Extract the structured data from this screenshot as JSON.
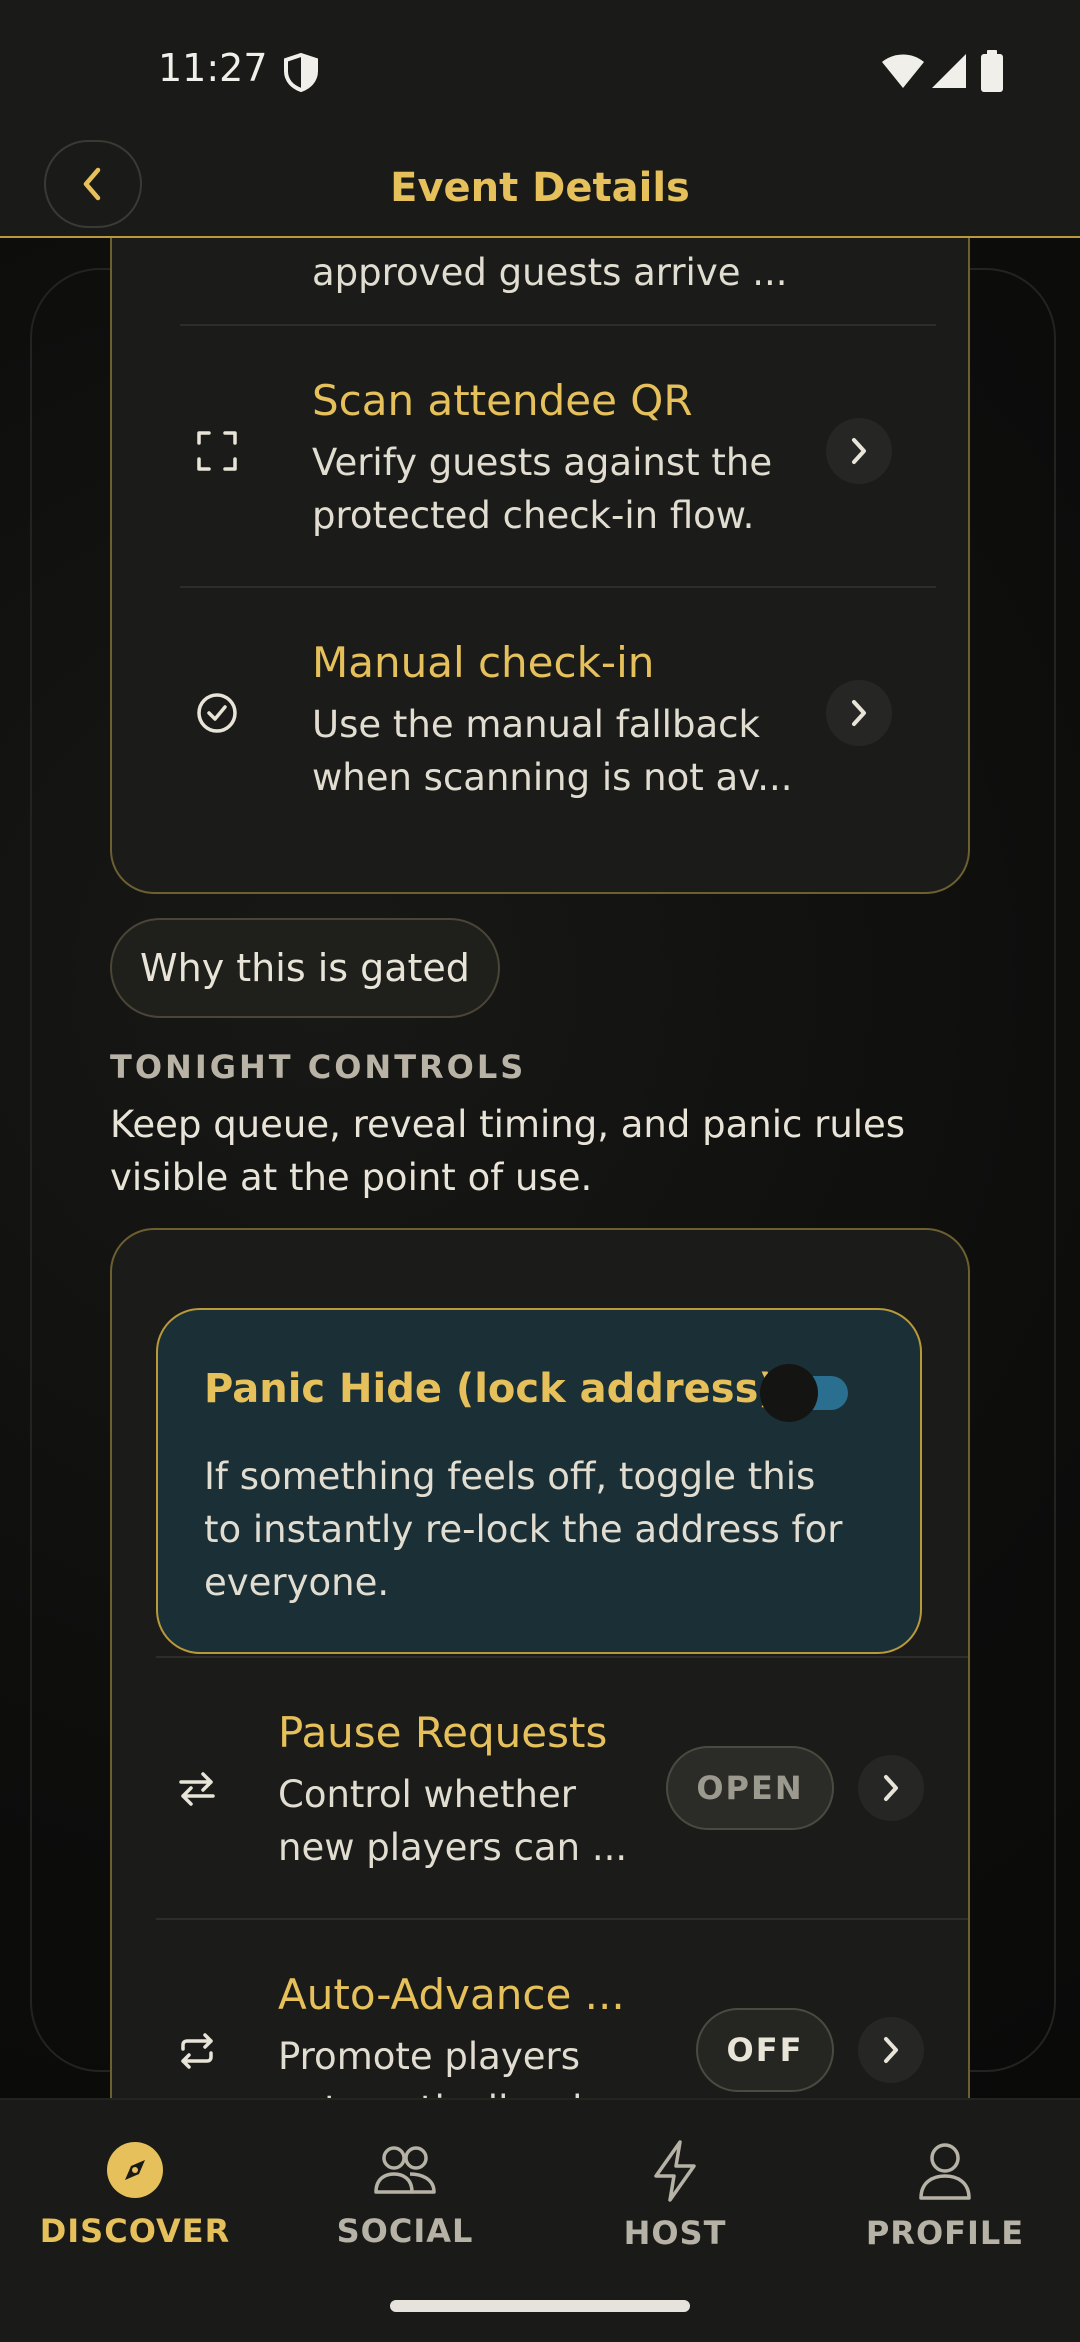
{
  "status_bar": {
    "time": "11:27"
  },
  "app_bar": {
    "title": "Event Details"
  },
  "checkin_card": {
    "partial_text": "approved guests arrive ...",
    "rows": [
      {
        "title": "Scan attendee QR",
        "description": "Verify guests against the protected check-in flow.",
        "icon": "qr-scan-icon"
      },
      {
        "title": "Manual check-in",
        "description": "Use the manual fallback when scanning is not av...",
        "icon": "check-circle-icon"
      }
    ]
  },
  "gated_button": {
    "label": "Why this is gated"
  },
  "tonight_controls": {
    "label": "TONIGHT CONTROLS",
    "description": "Keep queue, reveal timing, and panic rules visible at the point of use.",
    "panic": {
      "title": "Panic Hide (lock address)",
      "description": "If something feels off, toggle this to instantly re-lock the address for everyone."
    },
    "rows": [
      {
        "title": "Pause Requests",
        "description": "Control whether new players can ...",
        "state": "OPEN",
        "icon": "swap-arrows-icon"
      },
      {
        "title": "Auto-Advance ...",
        "description": "Promote players automatically when...",
        "state": "OFF",
        "icon": "repeat-icon"
      }
    ]
  },
  "bottom_nav": {
    "items": [
      {
        "label": "DISCOVER",
        "active": true
      },
      {
        "label": "SOCIAL",
        "active": false
      },
      {
        "label": "HOST",
        "active": false
      },
      {
        "label": "PROFILE",
        "active": false
      }
    ]
  },
  "colors": {
    "accent": "#e6c05a",
    "background": "#0b0b0a",
    "panic_bg": "#1a2f36",
    "toggle_track": "#2a6f8f"
  }
}
